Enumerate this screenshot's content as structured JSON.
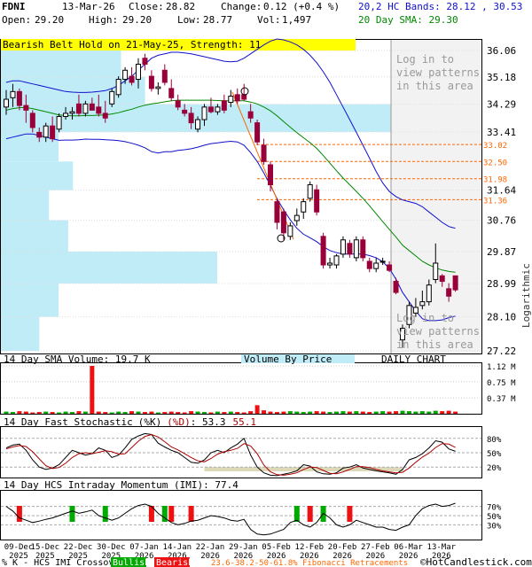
{
  "header": {
    "symbol": "FDNI",
    "date": "13-Mar-26",
    "close_label": "Close:",
    "close": "28.82",
    "change_label": "Change:",
    "change": "0.12 (+0.4 %)",
    "open_label": "Open:",
    "open": "29.20",
    "high_label": "High:",
    "high": "29.20",
    "low_label": "Low:",
    "low": "28.77",
    "vol_label": "Vol:",
    "vol": "1,497",
    "bands_text": "20,2 HC Bands: 28.12 , 30.53",
    "sma_text": "20 Day SMA: 29.30"
  },
  "pattern_banner": "Bearish Belt Hold on 21-May-25, Strength: 11",
  "login_lines": [
    "Log in to",
    "view patterns",
    "in this area"
  ],
  "volume_panel": {
    "title": "14 Day SMA Volume: 19.7 K",
    "by_price": "Volume By Price",
    "daily": "DAILY CHART"
  },
  "stoch_panel": {
    "title": "14 Day Fast Stochastic",
    "k_label": "(%K)",
    "d_label": "(%D)",
    "k_value": "53.3",
    "d_value": "55.1"
  },
  "imi_panel": {
    "title": "14 Day HCS Intraday Momentum (IMI): 77.4"
  },
  "footer": {
    "legend": "% K - HCS IMI Crossover:",
    "bullish": "Bullish",
    "bearish": "Bearish",
    "fib": "23.6-38.2-50-61.8% Fibonacci Retracements",
    "credit": "©HotCandlestick.com"
  },
  "side_label": "Logarithmic",
  "colors": {
    "up": "#000000",
    "down": "#99003a",
    "bands": "#1010cc",
    "sma": "#008800",
    "vbp": "#c0ecf8",
    "banner": "#ffff00",
    "login": "#999999",
    "fib": "#ff6600",
    "bullish": "#00aa00",
    "bearish": "#ee1111",
    "stoch_k": "#000000",
    "stoch_d": "#aa0000",
    "imi_up_color": "#00aa00"
  },
  "chart_data": {
    "type": "candlestick",
    "scale": "log",
    "ylim": [
      27.22,
      36.06
    ],
    "price_ticks": [
      "36.06",
      "35.18",
      "34.29",
      "33.41",
      "31.64",
      "30.76",
      "29.87",
      "28.99",
      "28.10",
      "27.22"
    ],
    "fib_levels": [
      "33.02",
      "32.50",
      "31.98",
      "31.36"
    ],
    "x_labels": [
      [
        "09-Dec",
        "2025"
      ],
      [
        "15-Dec",
        "2025"
      ],
      [
        "22-Dec",
        "2025"
      ],
      [
        "30-Dec",
        "2025"
      ],
      [
        "07-Jan",
        "2026"
      ],
      [
        "14-Jan",
        "2026"
      ],
      [
        "22-Jan",
        "2026"
      ],
      [
        "29-Jan",
        "2026"
      ],
      [
        "05-Feb",
        "2026"
      ],
      [
        "12-Feb",
        "2026"
      ],
      [
        "20-Feb",
        "2026"
      ],
      [
        "27-Feb",
        "2026"
      ],
      [
        "06-Mar",
        "2026"
      ],
      [
        "13-Mar",
        "2026"
      ]
    ],
    "candles": [
      {
        "o": 34.2,
        "h": 34.75,
        "l": 33.95,
        "c": 34.45
      },
      {
        "o": 34.5,
        "h": 34.95,
        "l": 34.2,
        "c": 34.7
      },
      {
        "o": 34.7,
        "h": 34.8,
        "l": 34.1,
        "c": 34.25
      },
      {
        "o": 34.25,
        "h": 34.6,
        "l": 33.7,
        "c": 34.1
      },
      {
        "o": 34.0,
        "h": 34.1,
        "l": 33.4,
        "c": 33.55
      },
      {
        "o": 33.4,
        "h": 33.55,
        "l": 33.1,
        "c": 33.25
      },
      {
        "o": 33.25,
        "h": 33.7,
        "l": 33.1,
        "c": 33.6
      },
      {
        "o": 33.6,
        "h": 33.9,
        "l": 33.1,
        "c": 33.2
      },
      {
        "o": 33.5,
        "h": 34.0,
        "l": 33.4,
        "c": 33.9
      },
      {
        "o": 33.9,
        "h": 34.2,
        "l": 33.8,
        "c": 34.0
      },
      {
        "o": 34.0,
        "h": 34.2,
        "l": 33.8,
        "c": 34.05
      },
      {
        "o": 34.3,
        "h": 34.6,
        "l": 33.9,
        "c": 34.0
      },
      {
        "o": 34.0,
        "h": 34.4,
        "l": 33.9,
        "c": 34.3
      },
      {
        "o": 34.3,
        "h": 34.5,
        "l": 34.1,
        "c": 34.1
      },
      {
        "o": 34.2,
        "h": 34.6,
        "l": 33.9,
        "c": 34.0
      },
      {
        "o": 34.0,
        "h": 34.4,
        "l": 33.7,
        "c": 33.85
      },
      {
        "o": 34.3,
        "h": 34.8,
        "l": 34.2,
        "c": 34.7
      },
      {
        "o": 34.6,
        "h": 35.2,
        "l": 34.5,
        "c": 35.1
      },
      {
        "o": 35.1,
        "h": 35.5,
        "l": 34.95,
        "c": 35.4
      },
      {
        "o": 35.2,
        "h": 35.5,
        "l": 34.9,
        "c": 35.0
      },
      {
        "o": 35.1,
        "h": 35.8,
        "l": 34.8,
        "c": 35.6
      },
      {
        "o": 35.8,
        "h": 35.95,
        "l": 35.4,
        "c": 35.6
      },
      {
        "o": 35.2,
        "h": 35.4,
        "l": 34.7,
        "c": 34.8
      },
      {
        "o": 34.8,
        "h": 35.0,
        "l": 34.6,
        "c": 34.85
      },
      {
        "o": 35.4,
        "h": 35.6,
        "l": 34.9,
        "c": 35.0
      },
      {
        "o": 34.8,
        "h": 35.1,
        "l": 34.4,
        "c": 34.5
      },
      {
        "o": 34.4,
        "h": 34.6,
        "l": 34.1,
        "c": 34.2
      },
      {
        "o": 34.1,
        "h": 34.3,
        "l": 33.9,
        "c": 34.0
      },
      {
        "o": 34.0,
        "h": 34.2,
        "l": 33.5,
        "c": 33.7
      },
      {
        "o": 33.5,
        "h": 33.9,
        "l": 33.4,
        "c": 33.8
      },
      {
        "o": 33.8,
        "h": 34.3,
        "l": 33.6,
        "c": 34.2
      },
      {
        "o": 34.2,
        "h": 34.5,
        "l": 34.0,
        "c": 34.05
      },
      {
        "o": 34.05,
        "h": 34.3,
        "l": 33.95,
        "c": 34.2
      },
      {
        "o": 34.4,
        "h": 34.6,
        "l": 34.0,
        "c": 34.1
      },
      {
        "o": 34.35,
        "h": 34.75,
        "l": 34.2,
        "c": 34.55
      },
      {
        "o": 34.6,
        "h": 34.8,
        "l": 34.3,
        "c": 34.4
      },
      {
        "o": 34.6,
        "h": 34.95,
        "l": 34.4,
        "c": 34.45
      },
      {
        "o": 34.05,
        "h": 34.3,
        "l": 33.7,
        "c": 33.85
      },
      {
        "o": 33.7,
        "h": 33.8,
        "l": 33.0,
        "c": 33.1
      },
      {
        "o": 33.0,
        "h": 33.2,
        "l": 32.4,
        "c": 32.5
      },
      {
        "o": 32.4,
        "h": 32.5,
        "l": 31.6,
        "c": 31.8
      },
      {
        "o": 31.3,
        "h": 31.4,
        "l": 30.5,
        "c": 30.7
      },
      {
        "o": 31.0,
        "h": 31.1,
        "l": 30.2,
        "c": 30.4
      },
      {
        "o": 30.3,
        "h": 30.7,
        "l": 30.2,
        "c": 30.6
      },
      {
        "o": 30.75,
        "h": 31.1,
        "l": 30.6,
        "c": 30.9
      },
      {
        "o": 31.0,
        "h": 31.4,
        "l": 30.8,
        "c": 31.3
      },
      {
        "o": 31.4,
        "h": 31.9,
        "l": 31.3,
        "c": 31.8
      },
      {
        "o": 31.65,
        "h": 31.8,
        "l": 30.9,
        "c": 31.0
      },
      {
        "o": 30.3,
        "h": 30.4,
        "l": 29.4,
        "c": 29.5
      },
      {
        "o": 29.5,
        "h": 29.7,
        "l": 29.4,
        "c": 29.55
      },
      {
        "o": 29.5,
        "h": 29.8,
        "l": 29.4,
        "c": 29.75
      },
      {
        "o": 29.8,
        "h": 30.3,
        "l": 29.7,
        "c": 30.2
      },
      {
        "o": 30.1,
        "h": 30.2,
        "l": 29.7,
        "c": 29.8
      },
      {
        "o": 29.7,
        "h": 30.3,
        "l": 29.6,
        "c": 30.2
      },
      {
        "o": 30.2,
        "h": 30.3,
        "l": 29.6,
        "c": 29.7
      },
      {
        "o": 29.6,
        "h": 29.7,
        "l": 29.3,
        "c": 29.4
      },
      {
        "o": 29.4,
        "h": 29.7,
        "l": 29.3,
        "c": 29.55
      },
      {
        "o": 29.6,
        "h": 29.7,
        "l": 29.5,
        "c": 29.6
      },
      {
        "o": 29.5,
        "h": 29.6,
        "l": 29.3,
        "c": 29.35
      },
      {
        "o": 29.05,
        "h": 29.15,
        "l": 28.7,
        "c": 28.75
      },
      {
        "o": 27.5,
        "h": 27.9,
        "l": 27.3,
        "c": 27.8
      },
      {
        "o": 27.9,
        "h": 28.5,
        "l": 27.8,
        "c": 28.4
      },
      {
        "o": 28.2,
        "h": 28.6,
        "l": 28.1,
        "c": 28.35
      },
      {
        "o": 28.4,
        "h": 28.8,
        "l": 28.3,
        "c": 28.5
      },
      {
        "o": 28.5,
        "h": 29.1,
        "l": 28.4,
        "c": 28.95
      },
      {
        "o": 29.1,
        "h": 30.1,
        "l": 29.0,
        "c": 29.55
      },
      {
        "o": 29.2,
        "h": 29.25,
        "l": 28.9,
        "c": 29.05
      },
      {
        "o": 28.85,
        "h": 29.0,
        "l": 28.5,
        "c": 28.65
      },
      {
        "o": 29.2,
        "h": 29.2,
        "l": 28.77,
        "c": 28.82
      }
    ],
    "sma20": [
      34.1,
      34.15,
      34.18,
      34.18,
      34.15,
      34.1,
      34.05,
      34.0,
      33.95,
      33.93,
      33.92,
      33.92,
      33.93,
      33.93,
      33.94,
      33.95,
      33.98,
      34.02,
      34.08,
      34.13,
      34.2,
      34.26,
      34.3,
      34.33,
      34.37,
      34.4,
      34.42,
      34.42,
      34.42,
      34.42,
      34.42,
      34.42,
      34.41,
      34.4,
      34.4,
      34.4,
      34.4,
      34.36,
      34.3,
      34.2,
      34.08,
      33.92,
      33.74,
      33.56,
      33.39,
      33.23,
      33.08,
      32.9,
      32.68,
      32.45,
      32.22,
      32.0,
      31.8,
      31.6,
      31.4,
      31.18,
      30.95,
      30.72,
      30.5,
      30.28,
      30.05,
      29.9,
      29.75,
      29.6,
      29.5,
      29.42,
      29.36,
      29.32,
      29.3
    ],
    "upper_band": [
      35.0,
      35.05,
      35.05,
      35.0,
      34.95,
      34.9,
      34.85,
      34.8,
      34.75,
      34.7,
      34.68,
      34.67,
      34.67,
      34.68,
      34.7,
      34.73,
      34.8,
      34.9,
      35.05,
      35.2,
      35.4,
      35.6,
      35.8,
      35.9,
      35.95,
      36.0,
      36.0,
      35.98,
      35.95,
      35.9,
      35.85,
      35.8,
      35.75,
      35.7,
      35.68,
      35.7,
      35.8,
      35.95,
      36.1,
      36.25,
      36.38,
      36.45,
      36.42,
      36.35,
      36.25,
      36.1,
      35.9,
      35.65,
      35.35,
      35.0,
      34.6,
      34.2,
      33.8,
      33.4,
      33.0,
      32.6,
      32.2,
      31.85,
      31.6,
      31.45,
      31.35,
      31.3,
      31.25,
      31.15,
      31.0,
      30.85,
      30.7,
      30.58,
      30.53
    ],
    "lower_band": [
      33.2,
      33.25,
      33.3,
      33.35,
      33.35,
      33.3,
      33.25,
      33.2,
      33.15,
      33.16,
      33.16,
      33.17,
      33.19,
      33.18,
      33.18,
      33.17,
      33.16,
      33.14,
      33.11,
      33.06,
      33.0,
      32.92,
      32.8,
      32.76,
      32.8,
      32.8,
      32.84,
      32.86,
      32.89,
      32.94,
      33.0,
      33.05,
      33.07,
      33.1,
      33.12,
      33.1,
      33.0,
      32.77,
      32.5,
      32.15,
      31.78,
      31.39,
      31.06,
      30.77,
      30.53,
      30.36,
      30.26,
      30.15,
      30.01,
      29.9,
      29.84,
      29.8,
      29.8,
      29.8,
      29.8,
      29.76,
      29.7,
      29.59,
      29.4,
      29.11,
      28.75,
      28.5,
      28.25,
      28.05,
      28.0,
      28.0,
      28.02,
      28.08,
      28.12
    ],
    "volume": [
      0.05,
      0.04,
      0.06,
      0.05,
      0.03,
      0.04,
      0.05,
      0.04,
      0.03,
      0.05,
      0.04,
      0.06,
      0.05,
      1.12,
      0.05,
      0.04,
      0.03,
      0.05,
      0.04,
      0.06,
      0.05,
      0.04,
      0.05,
      0.03,
      0.04,
      0.05,
      0.04,
      0.03,
      0.06,
      0.05,
      0.04,
      0.03,
      0.05,
      0.04,
      0.05,
      0.04,
      0.03,
      0.06,
      0.2,
      0.08,
      0.05,
      0.04,
      0.05,
      0.06,
      0.05,
      0.04,
      0.05,
      0.06,
      0.05,
      0.04,
      0.05,
      0.06,
      0.05,
      0.06,
      0.05,
      0.04,
      0.05,
      0.06,
      0.05,
      0.06,
      0.07,
      0.06,
      0.05,
      0.06,
      0.05,
      0.07,
      0.06,
      0.07,
      0.05
    ],
    "volume_ticks": [
      "1.12 M",
      "0.75 M",
      "0.37 M"
    ],
    "stoch_ticks": [
      "80%",
      "50%",
      "20%"
    ],
    "stoch_k": [
      60,
      66,
      68,
      55,
      35,
      20,
      15,
      18,
      25,
      40,
      55,
      50,
      45,
      48,
      60,
      55,
      40,
      45,
      60,
      78,
      85,
      90,
      88,
      70,
      62,
      55,
      50,
      40,
      30,
      28,
      35,
      50,
      55,
      50,
      60,
      68,
      80,
      45,
      20,
      8,
      3,
      2,
      5,
      8,
      12,
      25,
      22,
      10,
      6,
      5,
      8,
      18,
      20,
      25,
      18,
      15,
      12,
      10,
      8,
      5,
      15,
      35,
      40,
      48,
      60,
      75,
      72,
      58,
      53
    ],
    "stoch_d": [
      58,
      62,
      65,
      63,
      52,
      37,
      23,
      17,
      19,
      28,
      40,
      48,
      50,
      48,
      51,
      54,
      52,
      47,
      48,
      61,
      74,
      84,
      88,
      83,
      73,
      62,
      56,
      48,
      40,
      33,
      31,
      38,
      47,
      52,
      55,
      59,
      69,
      64,
      48,
      24,
      10,
      4,
      3,
      5,
      8,
      15,
      20,
      19,
      13,
      7,
      6,
      10,
      15,
      21,
      21,
      19,
      15,
      12,
      10,
      8,
      9,
      18,
      30,
      41,
      49,
      61,
      69,
      68,
      61
    ],
    "stoch_zone": [
      30,
      60
    ],
    "imi_ticks": [
      "70%",
      "50%",
      "30%"
    ],
    "imi": [
      70,
      60,
      45,
      40,
      35,
      38,
      42,
      45,
      50,
      55,
      60,
      55,
      58,
      62,
      50,
      45,
      40,
      45,
      55,
      65,
      72,
      75,
      70,
      55,
      45,
      35,
      30,
      33,
      38,
      40,
      45,
      50,
      48,
      45,
      40,
      38,
      42,
      20,
      10,
      8,
      10,
      15,
      20,
      35,
      40,
      30,
      25,
      35,
      55,
      45,
      30,
      25,
      30,
      40,
      35,
      30,
      25,
      25,
      20,
      18,
      25,
      30,
      50,
      65,
      72,
      75,
      70,
      72,
      77
    ],
    "crossovers": [
      {
        "i": 2,
        "kind": "bearish"
      },
      {
        "i": 10,
        "kind": "bullish"
      },
      {
        "i": 15,
        "kind": "bullish"
      },
      {
        "i": 22,
        "kind": "bearish"
      },
      {
        "i": 24,
        "kind": "bullish"
      },
      {
        "i": 25,
        "kind": "bearish"
      },
      {
        "i": 28,
        "kind": "bearish"
      },
      {
        "i": 44,
        "kind": "bullish"
      },
      {
        "i": 46,
        "kind": "bearish"
      },
      {
        "i": 48,
        "kind": "bullish"
      },
      {
        "i": 52,
        "kind": "bearish"
      }
    ],
    "volume_by_price": [
      {
        "from": 36.06,
        "to": 35.18,
        "size": 0.25
      },
      {
        "from": 35.18,
        "to": 34.29,
        "size": 0.3
      },
      {
        "from": 34.29,
        "to": 33.41,
        "size": 1.0
      },
      {
        "from": 33.41,
        "to": 32.5,
        "size": 0.12
      },
      {
        "from": 32.5,
        "to": 31.64,
        "size": 0.15
      },
      {
        "from": 31.64,
        "to": 30.76,
        "size": 0.1
      },
      {
        "from": 30.76,
        "to": 29.87,
        "size": 0.14
      },
      {
        "from": 29.87,
        "to": 28.99,
        "size": 0.45
      },
      {
        "from": 28.99,
        "to": 28.1,
        "size": 0.12
      },
      {
        "from": 28.1,
        "to": 27.22,
        "size": 0.08
      }
    ]
  }
}
